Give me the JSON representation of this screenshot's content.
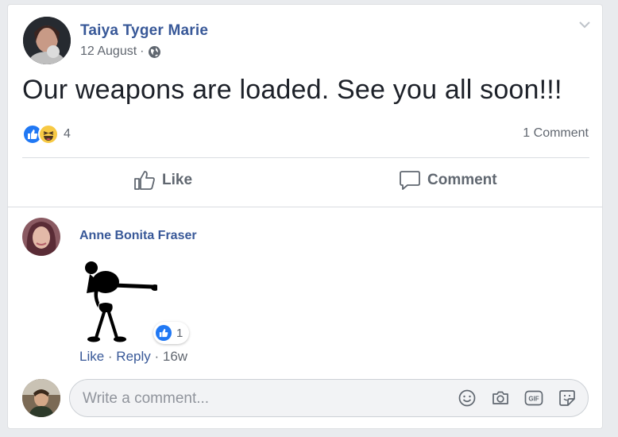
{
  "post": {
    "author": "Taiya Tyger Marie",
    "date": "12 August",
    "separator": "·",
    "text": "Our weapons are loaded. See you all soon!!!",
    "reaction_count": "4",
    "comment_count": "1 Comment",
    "reactions": [
      "like-icon",
      "haha-icon"
    ]
  },
  "actions": {
    "like_label": "Like",
    "comment_label": "Comment"
  },
  "comment": {
    "author": "Anne Bonita Fraser",
    "reaction_count": "1",
    "like_link": "Like",
    "reply_link": "Reply",
    "sep": " · ",
    "age": "16w"
  },
  "composer": {
    "placeholder": "Write a comment..."
  },
  "colors": {
    "link_blue": "#385898",
    "like_blue": "#2078f4",
    "haha_yellow": "#f7c944"
  }
}
